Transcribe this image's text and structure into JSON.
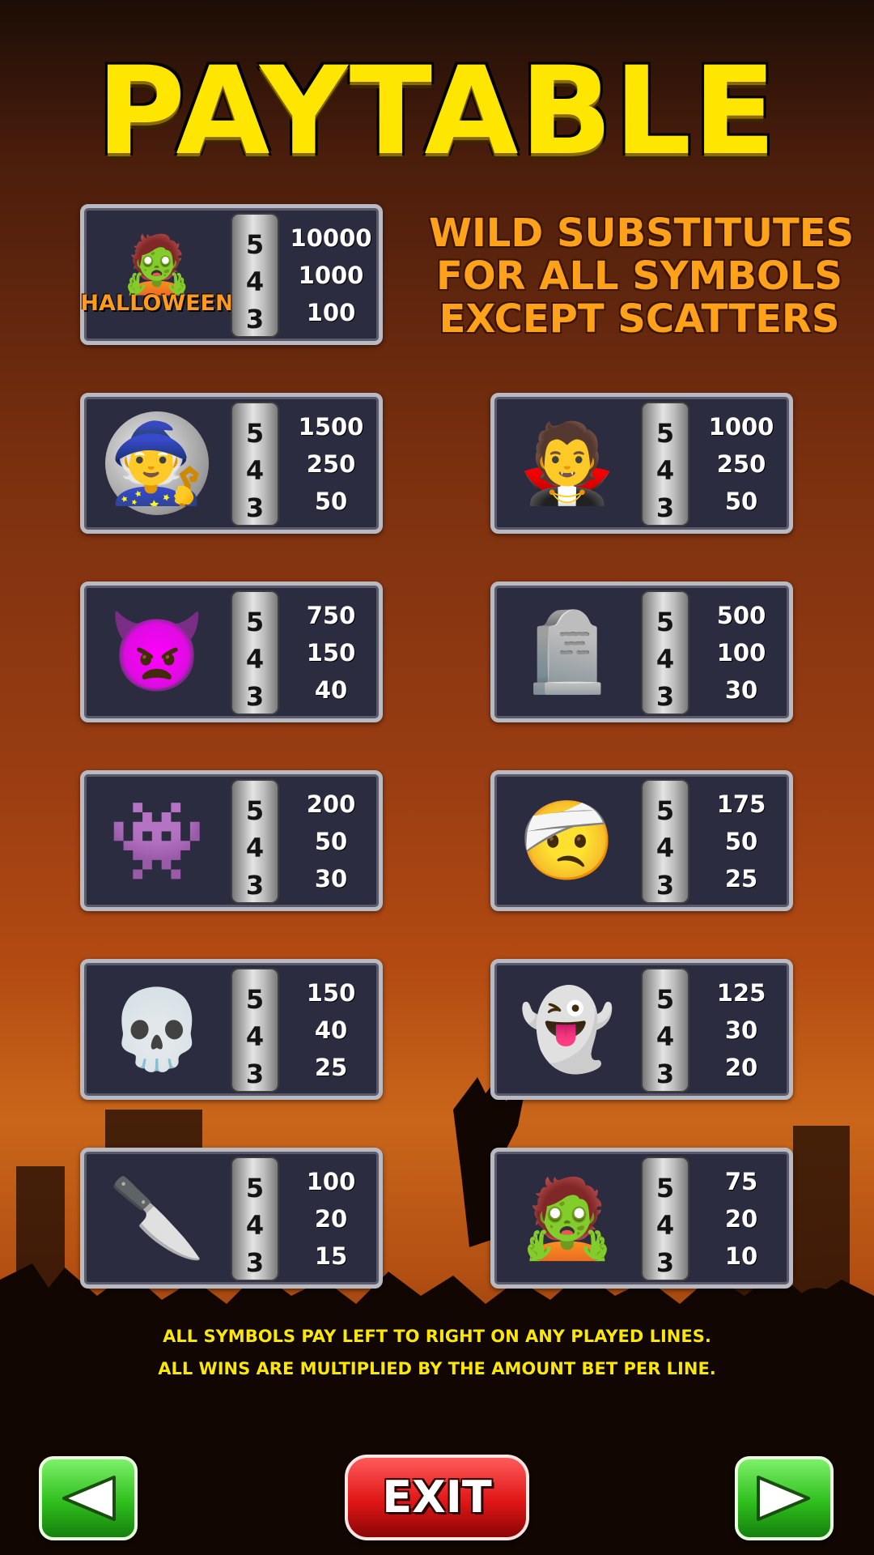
{
  "title": "PAYTABLE",
  "wild_note": {
    "lines": [
      "WILD SUBSTITUTES",
      "FOR ALL SYMBOLS",
      "EXCEPT SCATTERS"
    ]
  },
  "multipliers": [
    "5",
    "4",
    "3"
  ],
  "symbols": [
    {
      "icon": "frankenstein-wild-icon",
      "glyph": "🧟",
      "logo_text": "HALLOWEEN",
      "pays": [
        "10000",
        "1000",
        "100"
      ]
    },
    {
      "icon": "witch-icon",
      "glyph": "🧙",
      "pays": [
        "1500",
        "250",
        "50"
      ]
    },
    {
      "icon": "vampire-icon",
      "glyph": "🧛",
      "pays": [
        "1000",
        "250",
        "50"
      ]
    },
    {
      "icon": "devil-icon",
      "glyph": "👿",
      "pays": [
        "750",
        "150",
        "40"
      ]
    },
    {
      "icon": "tombstone-zombie-icon",
      "glyph": "🪦",
      "pays": [
        "500",
        "100",
        "30"
      ]
    },
    {
      "icon": "green-monster-icon",
      "glyph": "👾",
      "pays": [
        "200",
        "50",
        "30"
      ]
    },
    {
      "icon": "mummy-icon",
      "glyph": "🤕",
      "pays": [
        "175",
        "50",
        "25"
      ]
    },
    {
      "icon": "grim-reaper-icon",
      "glyph": "💀",
      "pays": [
        "150",
        "40",
        "25"
      ]
    },
    {
      "icon": "ghost-icon",
      "glyph": "👻",
      "pays": [
        "125",
        "30",
        "20"
      ]
    },
    {
      "icon": "hockey-mask-killer-icon",
      "glyph": "🔪",
      "pays": [
        "100",
        "20",
        "15"
      ]
    },
    {
      "icon": "zombie-icon",
      "glyph": "🧟",
      "pays": [
        "75",
        "20",
        "10"
      ]
    }
  ],
  "footer": {
    "line1": "ALL SYMBOLS PAY LEFT TO RIGHT ON ANY PLAYED LINES.",
    "line2": "ALL WINS ARE MULTIPLIED BY THE AMOUNT BET PER LINE."
  },
  "buttons": {
    "prev_icon": "left-arrow-icon",
    "exit_label": "EXIT",
    "next_icon": "right-arrow-icon"
  },
  "colors": {
    "title": "#ffe600",
    "wild_text": "#ffa21a",
    "card_bg": "#2c2c40",
    "nav_button": "#2fbf1d",
    "exit_button": "#e01616"
  }
}
